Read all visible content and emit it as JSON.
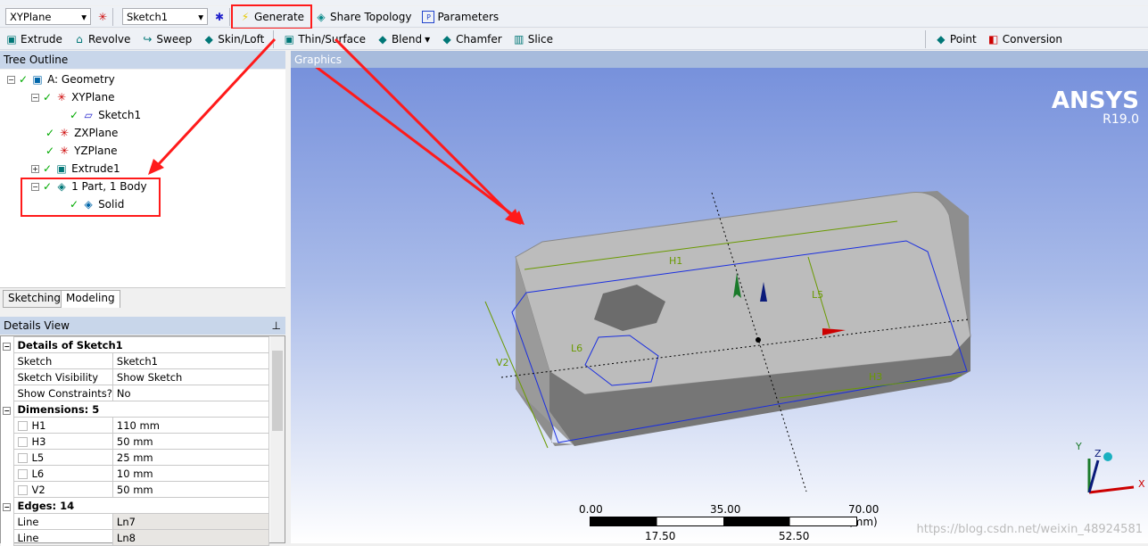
{
  "toolbar1": {
    "plane": "XYPlane",
    "sketch": "Sketch1",
    "generate": "Generate",
    "share_topology": "Share Topology",
    "parameters": "Parameters"
  },
  "toolbar2": {
    "extrude": "Extrude",
    "revolve": "Revolve",
    "sweep": "Sweep",
    "skin_loft": "Skin/Loft",
    "thin_surface": "Thin/Surface",
    "blend": "Blend",
    "chamfer": "Chamfer",
    "slice": "Slice",
    "point": "Point",
    "conversion": "Conversion"
  },
  "tree": {
    "title": "Tree Outline",
    "nodes": [
      "A: Geometry",
      "XYPlane",
      "Sketch1",
      "ZXPlane",
      "YZPlane",
      "Extrude1",
      "1 Part, 1 Body",
      "Solid"
    ]
  },
  "tabs": [
    "Sketching",
    "Modeling"
  ],
  "details": {
    "title": "Details View",
    "groups": [
      {
        "label": "Details of Sketch1",
        "rows": [
          [
            "Sketch",
            "Sketch1"
          ],
          [
            "Sketch Visibility",
            "Show Sketch"
          ],
          [
            "Show Constraints?",
            "No"
          ]
        ]
      },
      {
        "label": "Dimensions: 5",
        "rows": [
          [
            "H1",
            "110 mm"
          ],
          [
            "H3",
            "50 mm"
          ],
          [
            "L5",
            "25 mm"
          ],
          [
            "L6",
            "10 mm"
          ],
          [
            "V2",
            "50 mm"
          ]
        ]
      },
      {
        "label": "Edges: 14",
        "rows": [
          [
            "Line",
            "Ln7"
          ],
          [
            "Line",
            "Ln8"
          ]
        ]
      }
    ]
  },
  "graphics": {
    "title": "Graphics",
    "brand": "ANSYS",
    "version": "R19.0",
    "dims": [
      "H1",
      "L5",
      "L6",
      "V2",
      "H3"
    ],
    "scale": {
      "top": [
        "0.00",
        "35.00",
        "70.00 (mm)"
      ],
      "bottom": [
        "17.50",
        "52.50"
      ]
    },
    "axes": [
      "Y",
      "Z",
      "X"
    ],
    "watermark": "https://blog.csdn.net/weixin_48924581"
  },
  "colors": {
    "highlight": "#ff1a1a",
    "header": "#c8d6ea"
  }
}
